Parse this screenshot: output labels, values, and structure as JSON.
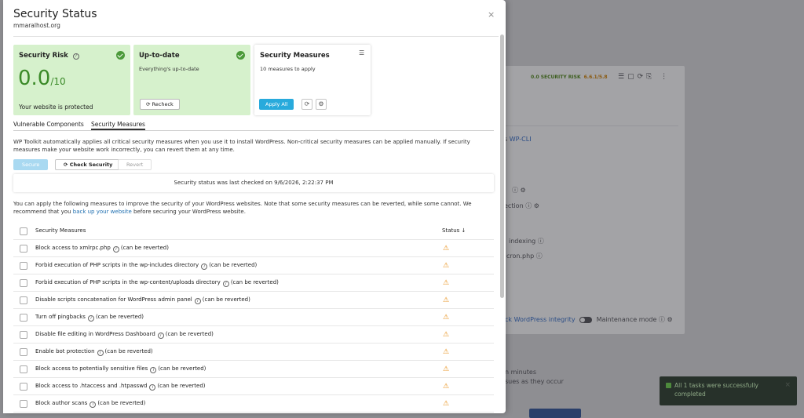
{
  "background": {
    "risk_badge": "0.0 SECURITY RISK",
    "version": "6.6.1/5.8",
    "rows": [
      "s",
      "WP-CLI",
      "ection",
      "indexing",
      "cron.php",
      "ck WordPress integrity",
      "Maintenance mode",
      "n minutes",
      "sues as they occur"
    ],
    "toast": "All 1 tasks were successfully completed"
  },
  "modal": {
    "title": "Security Status",
    "subtitle": "mmaralhost.org",
    "close": "×"
  },
  "cards": {
    "risk": {
      "title": "Security Risk",
      "score": "0.0",
      "score_den": "/10",
      "note": "Your website is protected"
    },
    "uptodate": {
      "title": "Up-to-date",
      "desc": "Everything's up-to-date",
      "button": "Recheck"
    },
    "measures": {
      "title": "Security Measures",
      "desc": "10 measures to apply",
      "button": "Apply All"
    }
  },
  "tabs": [
    {
      "label": "Vulnerable Components"
    },
    {
      "label": "Security Measures"
    }
  ],
  "intro": "WP Toolkit automatically applies all critical security measures when you use it to install WordPress. Non-critical security measures can be applied manually. If security measures make your website work incorrectly, you can revert them at any time.",
  "actions": {
    "secure": "Secure",
    "check": "Check Security",
    "revert": "Revert"
  },
  "last_checked": "Security status was last checked on 9/6/2026, 2:22:37 PM",
  "apply_text_1": "You can apply the following measures to improve the security of your WordPress websites. Note that some security measures can be reverted, while some cannot. We recommend that you",
  "apply_link": "back up your website",
  "apply_text_2": "before securing your WordPress website.",
  "table": {
    "col_measures": "Security Measures",
    "col_status": "Status ↓",
    "revert_note": "(can be reverted)",
    "rows": [
      "Block access to xmlrpc.php",
      "Forbid execution of PHP scripts in the wp-includes directory",
      "Forbid execution of PHP scripts in the wp-content/uploads directory",
      "Disable scripts concatenation for WordPress admin panel",
      "Turn off pingbacks",
      "Disable file editing in WordPress Dashboard",
      "Enable bot protection",
      "Block access to potentially sensitive files",
      "Block access to .htaccess and .htpasswd",
      "Block author scans"
    ]
  },
  "colors": {
    "accent": "#28aadc",
    "success": "#3b8a28",
    "warning": "#e8901a",
    "card_green": "#d6f1cc"
  }
}
